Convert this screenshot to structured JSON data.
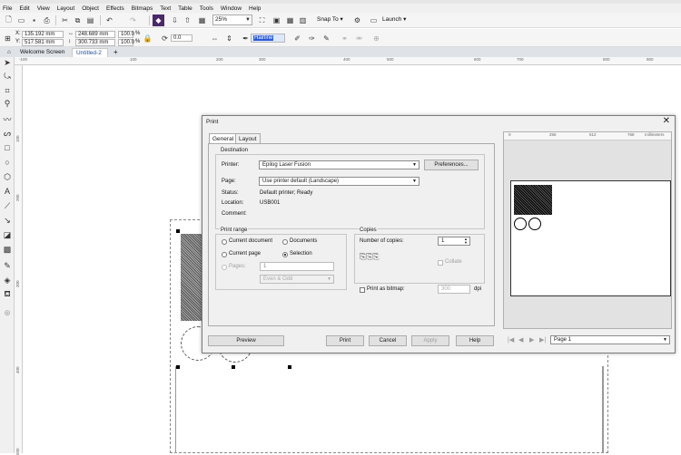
{
  "menu": [
    "File",
    "Edit",
    "View",
    "Layout",
    "Object",
    "Effects",
    "Bitmaps",
    "Text",
    "Table",
    "Tools",
    "Window",
    "Help"
  ],
  "toolbar": {
    "zoom": "25%",
    "snap_to": "Snap To",
    "launch": "Launch"
  },
  "property_bar": {
    "x": "135.192 mm",
    "y": "517.581 mm",
    "w": "248.689 mm",
    "h": "300.733 mm",
    "scale_w": "100.0",
    "scale_h": "100.0",
    "percent": "%",
    "rotation": "0.0",
    "outline": "Hairline"
  },
  "tabs": {
    "welcome": "Welcome Screen",
    "untitled": "Untitled-2",
    "add": "+"
  },
  "ruler_top": [
    "-100",
    "100",
    "200",
    "300",
    "400",
    "500",
    "600",
    "700",
    "800",
    "900"
  ],
  "ruler_left": [
    "100",
    "200",
    "300",
    "400",
    "500"
  ],
  "dialog": {
    "title": "Print",
    "close": "✕",
    "tab_general": "General",
    "tab_layout": "Layout",
    "destination": "Destination",
    "printer_label": "Printer:",
    "printer_value": "Epilog Laser Fusion",
    "preferences": "Preferences...",
    "page_label": "Page:",
    "page_value": "Use printer default (Landscape)",
    "status_label": "Status:",
    "status_value": "Default printer; Ready",
    "location_label": "Location:",
    "location_value": "USB001",
    "comment_label": "Comment:",
    "print_range": "Print range",
    "current_document": "Current document",
    "documents": "Documents",
    "current_page": "Current page",
    "selection": "Selection",
    "pages": "Pages:",
    "pages_value": "1",
    "even_odd": "Even & Odd",
    "copies": "Copies",
    "num_copies_label": "Number of copies:",
    "num_copies": "1",
    "collate": "Collate",
    "print_as_bitmap": "Print as bitmap:",
    "dpi_value": "300",
    "dpi": "dpi",
    "preview": "Preview",
    "print": "Print",
    "cancel": "Cancel",
    "apply": "Apply",
    "help": "Help",
    "preview_ruler": [
      "0",
      "256",
      "512",
      "768",
      "millimeters"
    ],
    "page_select": "Page 1"
  }
}
